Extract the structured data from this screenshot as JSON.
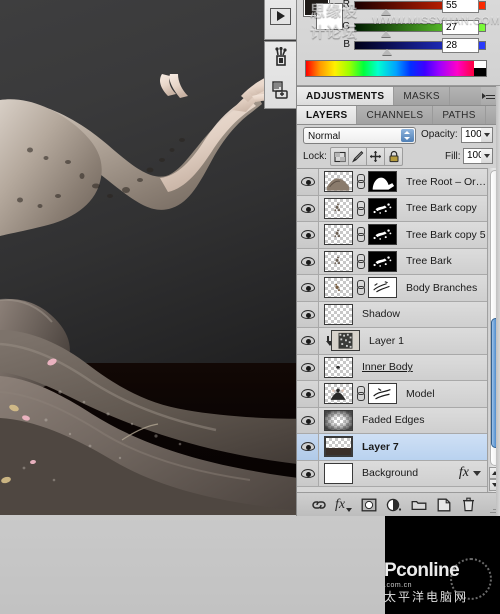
{
  "app": "Adobe Photoshop",
  "watermarks": {
    "top_cn": "思缘设计论坛",
    "top_en": "WWW.MISSYUAN.COM",
    "bottom_brand": "Pconline",
    "bottom_domain": ".com.cn",
    "bottom_cn": "太平洋电脑网"
  },
  "tool_strip": {
    "items": [
      {
        "name": "play-action-icon",
        "glyph": "▶"
      },
      {
        "name": "quick-mask-icon",
        "glyph": ""
      },
      {
        "name": "screen-mode-icon",
        "glyph": ""
      }
    ]
  },
  "color_panel": {
    "foreground_color": "#1e1a17",
    "background_color": "#ffffff",
    "sliders": [
      {
        "label": "R",
        "value": "55",
        "thumb_pct": 22
      },
      {
        "label": "G",
        "value": "27",
        "thumb_pct": 22
      },
      {
        "label": "B",
        "value": "28",
        "thumb_pct": 23
      }
    ],
    "spectrum_name": "color-spectrum-ramp"
  },
  "adjustments_tabs": {
    "tabs": [
      {
        "label": "ADJUSTMENTS",
        "active": true
      },
      {
        "label": "MASKS",
        "active": false
      }
    ]
  },
  "layers_tabs": {
    "tabs": [
      {
        "label": "LAYERS",
        "active": true
      },
      {
        "label": "CHANNELS",
        "active": false
      },
      {
        "label": "PATHS",
        "active": false
      }
    ]
  },
  "layers_panel": {
    "blend_mode": "Normal",
    "opacity_label": "Opacity:",
    "opacity_value": "100%",
    "lock_label": "Lock:",
    "lock_buttons": [
      {
        "name": "lock-transparent-pixels-icon"
      },
      {
        "name": "lock-image-pixels-icon"
      },
      {
        "name": "lock-position-icon"
      },
      {
        "name": "lock-all-icon"
      }
    ],
    "fill_label": "Fill:",
    "fill_value": "100%",
    "layers": [
      {
        "name": "Tree Root – Origina...",
        "type": "image-with-mask",
        "thumb": "texture",
        "mask": "silhouette",
        "visible": true,
        "selected": false,
        "clipped": false,
        "editing": false,
        "has_fx": false
      },
      {
        "name": "Tree Bark copy",
        "type": "image-with-mask",
        "thumb": "speck",
        "mask": "splatter",
        "visible": true,
        "selected": false,
        "clipped": false,
        "editing": false,
        "has_fx": false
      },
      {
        "name": "Tree Bark copy 5",
        "type": "image-with-mask",
        "thumb": "speck",
        "mask": "splatter",
        "visible": true,
        "selected": false,
        "clipped": false,
        "editing": false,
        "has_fx": false
      },
      {
        "name": "Tree Bark",
        "type": "image-with-mask",
        "thumb": "speck",
        "mask": "splatter",
        "visible": true,
        "selected": false,
        "clipped": false,
        "editing": false,
        "has_fx": false
      },
      {
        "name": "Body Branches",
        "type": "image-with-mask",
        "thumb": "speck",
        "mask": "strokes",
        "visible": true,
        "selected": false,
        "clipped": false,
        "editing": false,
        "has_fx": false
      },
      {
        "name": "Shadow",
        "type": "image",
        "thumb": "empty",
        "mask": null,
        "visible": true,
        "selected": false,
        "clipped": false,
        "editing": false,
        "has_fx": false
      },
      {
        "name": "Layer 1",
        "type": "image",
        "thumb": "noise",
        "mask": null,
        "visible": true,
        "selected": false,
        "clipped": true,
        "editing": false,
        "has_fx": false
      },
      {
        "name": "Inner Body",
        "type": "image",
        "thumb": "dot",
        "mask": null,
        "visible": true,
        "selected": false,
        "clipped": false,
        "editing": true,
        "has_fx": false
      },
      {
        "name": "Model",
        "type": "image-with-mask",
        "thumb": "figure",
        "mask": "strokes",
        "visible": true,
        "selected": false,
        "clipped": false,
        "editing": false,
        "has_fx": false
      },
      {
        "name": "Faded Edges",
        "type": "image",
        "thumb": "vignette",
        "mask": null,
        "visible": true,
        "selected": false,
        "clipped": false,
        "editing": false,
        "has_fx": false
      },
      {
        "name": "Layer 7",
        "type": "image",
        "thumb": "band",
        "mask": null,
        "visible": true,
        "selected": true,
        "clipped": false,
        "editing": false,
        "has_fx": false
      },
      {
        "name": "Background",
        "type": "image",
        "thumb": "white",
        "mask": null,
        "visible": true,
        "selected": false,
        "clipped": false,
        "editing": false,
        "has_fx": true,
        "fx_label": "fx"
      }
    ],
    "scrollbar": {
      "name": "layers-scrollbar",
      "thumb_top_pct": 53,
      "thumb_height_pct": 40
    },
    "bottom_buttons": [
      {
        "name": "link-layers-button",
        "title": "Link layers"
      },
      {
        "name": "layer-style-button",
        "title": "Add a layer style"
      },
      {
        "name": "add-layer-mask-button",
        "title": "Add layer mask"
      },
      {
        "name": "new-adjustment-layer-button",
        "title": "Create new fill or adjustment layer"
      },
      {
        "name": "new-group-button",
        "title": "Create a new group"
      },
      {
        "name": "new-layer-button",
        "title": "Create a new layer"
      },
      {
        "name": "delete-layer-button",
        "title": "Delete layer"
      }
    ]
  }
}
